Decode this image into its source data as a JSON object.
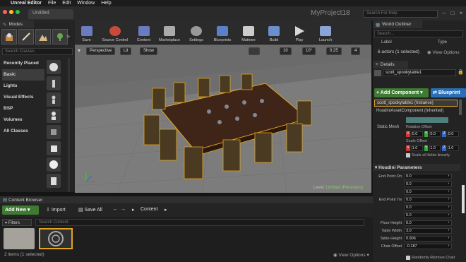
{
  "menubar": {
    "app": "Unreal Editor",
    "items": [
      "File",
      "Edit",
      "Window",
      "Help"
    ]
  },
  "titlebar": {
    "tab": "Untitled",
    "project": "MyProject18",
    "search_placeholder": "Search For Help"
  },
  "modes": {
    "tab_label": "Modes",
    "search_placeholder": "Search Classes",
    "categories": [
      "Recently Placed",
      "Basic",
      "Lights",
      "Visual Effects",
      "BSP",
      "Volumes",
      "All Classes"
    ],
    "active_category": "Basic"
  },
  "toolbar": {
    "buttons": [
      "Save",
      "Source Control",
      "Content",
      "Marketplace",
      "Settings",
      "Blueprints",
      "Matinee",
      "Build",
      "Play",
      "Launch"
    ]
  },
  "viewport": {
    "perspective": "Perspective",
    "lit": "Lit",
    "show": "Show",
    "grid_snap": "10",
    "rot_snap": "10°",
    "scale_snap": "0.25",
    "cam_speed": "4",
    "level_label": "Level:",
    "level_name": "Untitled (Persistent)"
  },
  "content_browser": {
    "tab_label": "Content Browser",
    "add_new": "Add New",
    "import": "Import",
    "save_all": "Save All",
    "path": "Content",
    "filters": "Filters",
    "search_placeholder": "Search Content",
    "items_count": "2 items (1 selected)",
    "view_options": "View Options"
  },
  "world_outliner": {
    "tab_label": "World Outliner",
    "search_placeholder": "Search...",
    "col_label": "Label",
    "col_type": "Type",
    "actors_count": "6 actors (1 selected)",
    "view_options": "View Options"
  },
  "details": {
    "tab_label": "Details",
    "actor_name": "scott_spookytable1",
    "add_component": "+ Add Component",
    "blueprint": "Blueprint",
    "instance_label": "scott_spookytable1 (Instance)",
    "component_label": "HoudiniAssetComponent (Inherited)",
    "static_mesh_label": "Static Mesh",
    "rotation_offset": "Rotation Offset",
    "rot_values": [
      "0.0",
      "0.0",
      "0.0"
    ],
    "scale_offset": "Scale Offset",
    "scale_values": [
      "1.0",
      "1.0",
      "1.0"
    ],
    "scale_uniform": "Scale all fields linearly",
    "houdini_section": "Houdini Parameters",
    "params": [
      {
        "label": "End Point On",
        "value": "0.0"
      },
      {
        "label": "",
        "value": "0.0"
      },
      {
        "label": "",
        "value": "0.0"
      },
      {
        "label": "End Point Tw",
        "value": "0.0"
      },
      {
        "label": "",
        "value": "0.0"
      },
      {
        "label": "",
        "value": "5.0"
      },
      {
        "label": "Floor Height",
        "value": "0.0"
      },
      {
        "label": "Table Width",
        "value": "3.0"
      },
      {
        "label": "Table Height",
        "value": "0.906"
      },
      {
        "label": "Chair Offset",
        "value": "-0.187"
      }
    ],
    "random_remove": "Randomly Remove Chair"
  },
  "colors": {
    "accent_green": "#3d7a32",
    "accent_blue": "#2a6fb5",
    "selection_orange": "#e0a322"
  }
}
